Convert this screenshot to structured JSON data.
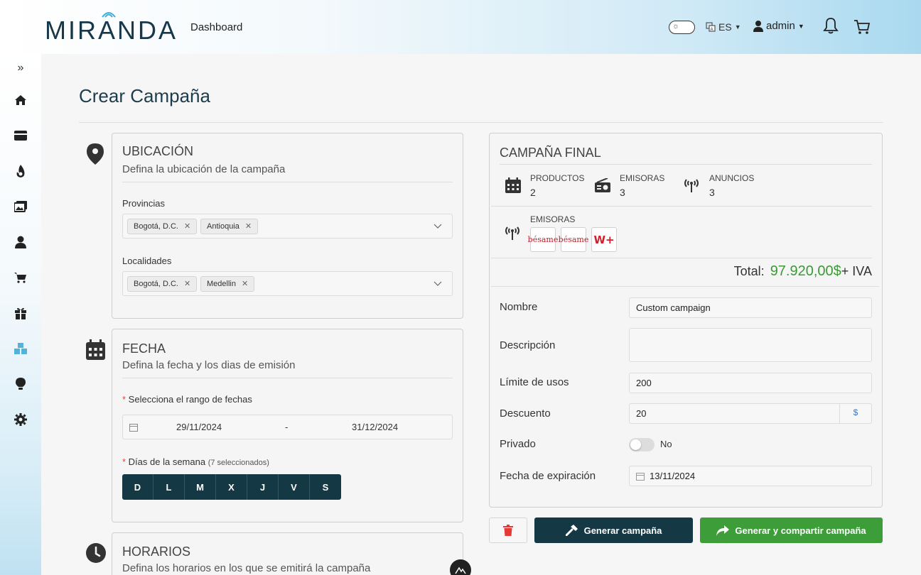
{
  "header": {
    "logo_text": "MIRANDA",
    "nav_link": "Dashboard",
    "language": "ES",
    "user": "admin"
  },
  "sidebar": {
    "items": [
      "home",
      "card",
      "fire",
      "images",
      "user",
      "cart",
      "gift",
      "boxes",
      "bulb",
      "gear"
    ]
  },
  "page": {
    "title": "Crear Campaña"
  },
  "ubicacion": {
    "title": "UBICACIÓN",
    "subtitle": "Defina la ubicación de la campaña",
    "provincias_label": "Provincias",
    "provincias": [
      "Bogotá, D.C.",
      "Antioquia"
    ],
    "localidades_label": "Localidades",
    "localidades": [
      "Bogotá, D.C.",
      "Medellin"
    ]
  },
  "fecha": {
    "title": "FECHA",
    "subtitle": "Defina la fecha y los dias de emisión",
    "range_label": "Selecciona el rango de fechas",
    "start": "29/11/2024",
    "separator": "-",
    "end": "31/12/2024",
    "days_label": "Días de la semana",
    "days_count": "(7 seleccionados)",
    "days": [
      "D",
      "L",
      "M",
      "X",
      "J",
      "V",
      "S"
    ]
  },
  "horarios": {
    "title": "HORARIOS",
    "subtitle": "Defina los horarios en los que se emitirá la campaña"
  },
  "final": {
    "title": "CAMPAÑA FINAL",
    "productos_label": "PRODUCTOS",
    "productos": "2",
    "emisoras_label": "EMISORAS",
    "emisoras": "3",
    "anuncios_label": "ANUNCIOS",
    "anuncios": "3",
    "emisoras_list_label": "EMISORAS",
    "station_logos": [
      "bésame",
      "bésame",
      "W+"
    ],
    "total_label": "Total:",
    "total_amount": "97.920,00",
    "currency": "$",
    "total_suffix": "+ IVA"
  },
  "form": {
    "nombre_label": "Nombre",
    "nombre": "Custom campaign",
    "descripcion_label": "Descripción",
    "descripcion": "",
    "limite_label": "Límite de usos",
    "limite": "200",
    "descuento_label": "Descuento",
    "descuento": "20",
    "descuento_unit": "$",
    "privado_label": "Privado",
    "privado": "No",
    "expiracion_label": "Fecha de expiración",
    "expiracion": "13/11/2024"
  },
  "actions": {
    "generate": "Generar campaña",
    "generate_share": "Generar y compartir campaña"
  },
  "colors": {
    "primary": "#153845",
    "success": "#3c9d39",
    "danger": "#e53935",
    "total_green": "#3a9a34"
  }
}
